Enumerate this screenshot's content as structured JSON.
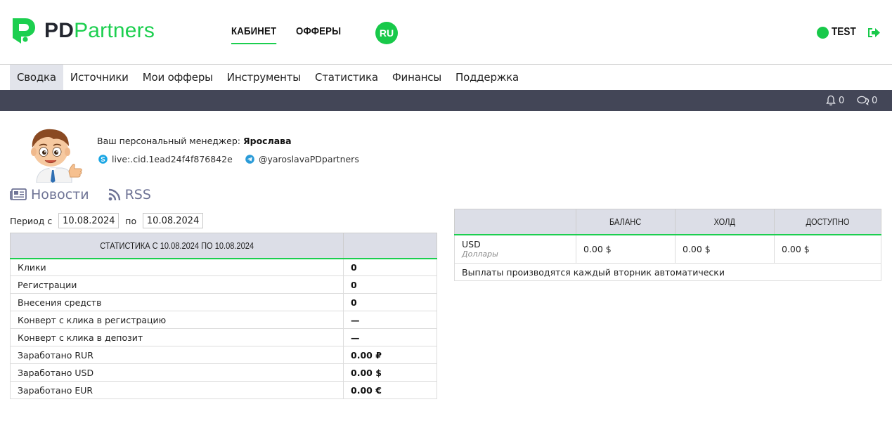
{
  "header": {
    "logo_pd": "PD",
    "logo_partners": "Partners",
    "nav": [
      {
        "label": "КАБИНЕТ",
        "active": true
      },
      {
        "label": "ОФФЕРЫ",
        "active": false
      }
    ],
    "language": "RU",
    "user_name": "TEST",
    "accent_color": "#1ccf4f"
  },
  "menu": {
    "items": [
      {
        "label": "Сводка",
        "active": true
      },
      {
        "label": "Источники"
      },
      {
        "label": "Мои офферы"
      },
      {
        "label": "Инструменты"
      },
      {
        "label": "Статистика"
      },
      {
        "label": "Финансы"
      },
      {
        "label": "Поддержка"
      }
    ]
  },
  "notifications": {
    "bell_count": "0",
    "messages_count": "0"
  },
  "manager": {
    "label": "Ваш персональный менеджер:",
    "name": "Ярослава",
    "skype": "live:.cid.1ead24f4f876842e",
    "telegram": "@yaroslavaPDpartners"
  },
  "feeds": {
    "news": "Новости",
    "rss": "RSS"
  },
  "period": {
    "from_label": "Период с",
    "from_value": "10.08.2024",
    "to_label": "по",
    "to_value": "10.08.2024"
  },
  "stats": {
    "header": "Статистика с 10.08.2024 по 10.08.2024",
    "rows": [
      {
        "label": "Клики",
        "value": "0"
      },
      {
        "label": "Регистрации",
        "value": "0"
      },
      {
        "label": "Внесения средств",
        "value": "0"
      },
      {
        "label": "Конверт с клика в регистрацию",
        "value": "—"
      },
      {
        "label": "Конверт с клика в депозит",
        "value": "—"
      },
      {
        "label": "Заработано RUR",
        "value": "0.00 ₽"
      },
      {
        "label": "Заработано USD",
        "value": "0.00 $"
      },
      {
        "label": "Заработано EUR",
        "value": "0.00 €"
      }
    ]
  },
  "balance": {
    "columns": [
      "Баланс",
      "Холд",
      "Доступно"
    ],
    "rows": [
      {
        "code": "USD",
        "name": "Доллары",
        "balance": "0.00 $",
        "hold": "0.00 $",
        "available": "0.00 $"
      }
    ],
    "note": "Выплаты производятся каждый вторник автоматически"
  }
}
